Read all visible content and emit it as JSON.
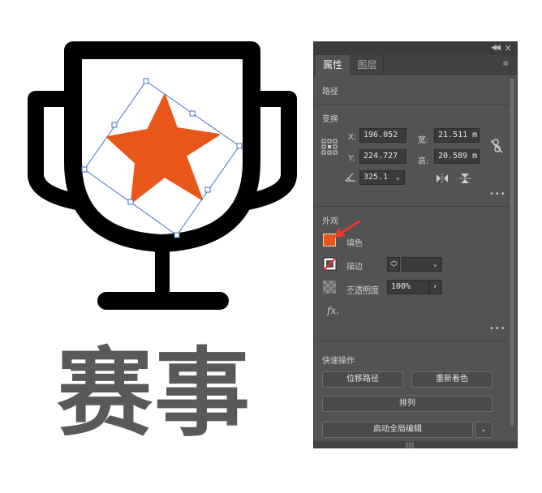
{
  "artwork": {
    "title": "赛事",
    "colors": {
      "trophy": "#000000",
      "star": "#E8561A",
      "selection": "#4472C4",
      "title_text": "#595959"
    }
  },
  "panel": {
    "tabs": [
      {
        "label": "属性",
        "active": true
      },
      {
        "label": "图层",
        "active": false
      }
    ],
    "sections": {
      "path": {
        "title": "路径"
      },
      "transform": {
        "title": "变换",
        "x_label": "X:",
        "x_value": "196.052",
        "y_label": "Y:",
        "y_value": "224.727",
        "width_label": "宽:",
        "width_value": "21.511 m",
        "height_label": "高:",
        "height_value": "20.589 m",
        "angle_value": "325.1"
      },
      "appearance": {
        "title": "外观",
        "fill_label": "填色",
        "fill_color": "#E8561A",
        "stroke_label": "描边",
        "opacity_label": "不透明度",
        "opacity_value": "100%",
        "fx_label": "fx."
      },
      "quick_actions": {
        "title": "快速操作",
        "offset_path": "位移路径",
        "recolor": "重新着色",
        "arrange": "排列",
        "global_edit": "启动全局编辑"
      }
    },
    "colors": {
      "background": "#535353",
      "accent_arrow": "#E83A2E"
    }
  }
}
